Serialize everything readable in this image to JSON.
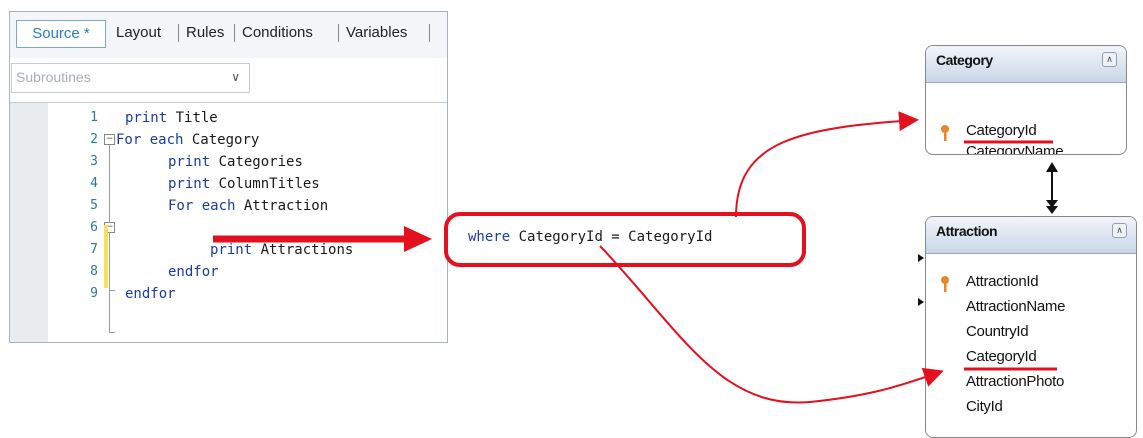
{
  "tabs": [
    {
      "label": "Source *",
      "active": true
    },
    {
      "label": "Layout",
      "active": false
    },
    {
      "label": "Rules",
      "active": false
    },
    {
      "label": "Conditions",
      "active": false
    },
    {
      "label": "Variables",
      "active": false
    }
  ],
  "dropdown": {
    "value": "Subroutines"
  },
  "code": {
    "line_numbers": [
      "1",
      "2",
      "3",
      "4",
      "5",
      "6",
      "7",
      "8",
      "9"
    ],
    "lines": [
      {
        "kw": "print",
        "rest": " Title"
      },
      {
        "kw": "For each",
        "rest": " Category"
      },
      {
        "kw": "print",
        "rest": " Categories"
      },
      {
        "kw": "print",
        "rest": " ColumnTitles"
      },
      {
        "kw": "For each",
        "rest": " Attraction"
      },
      {
        "kw": "",
        "rest": ""
      },
      {
        "kw": "print",
        "rest": " Attractions"
      },
      {
        "kw": "endfor",
        "rest": ""
      },
      {
        "kw": "endfor",
        "rest": ""
      }
    ]
  },
  "where_clause": {
    "kw": "where",
    "rest": " CategoryId = CategoryId"
  },
  "entities": {
    "category": {
      "title": "Category",
      "attributes": [
        "CategoryId",
        "CategoryName"
      ]
    },
    "attraction": {
      "title": "Attraction",
      "attributes": [
        "AttractionId",
        "AttractionName",
        "CountryId",
        "CategoryId",
        "AttractionPhoto",
        "CityId"
      ]
    }
  },
  "colors": {
    "annotation_red": "#e5101d",
    "keyword_blue": "#1a3aa8",
    "line_number": "#2b7a9c",
    "active_tab": "#2a7bbd",
    "key_icon": "#e8862a"
  },
  "icons": [
    "key-icon",
    "collapse-icon",
    "chevron-down-icon",
    "fold-toggle-icon"
  ]
}
